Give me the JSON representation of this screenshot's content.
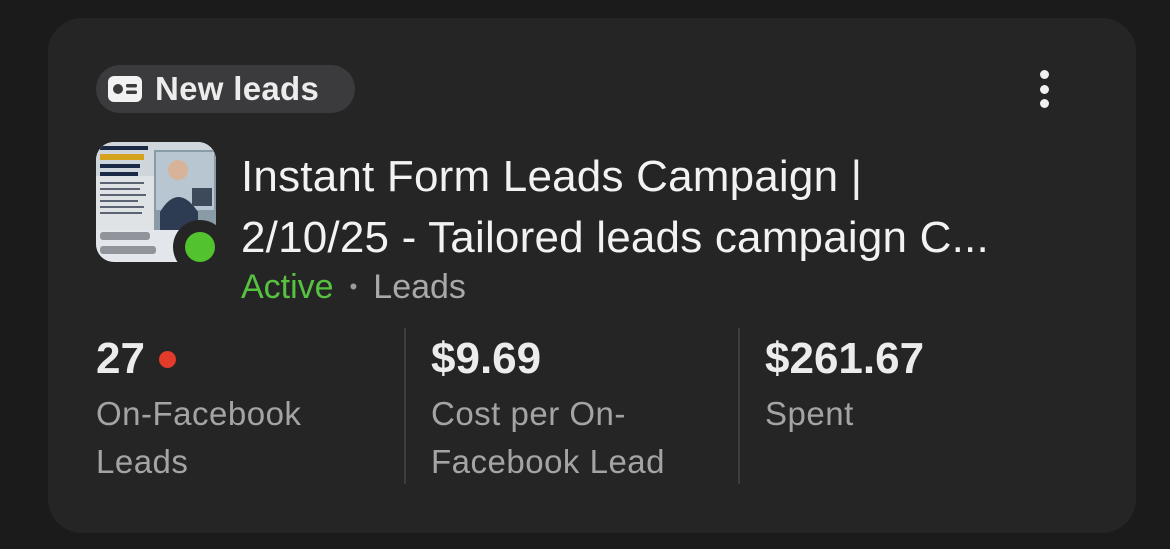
{
  "badge": {
    "label": "New leads",
    "icon": "lead-form-icon"
  },
  "menu": {
    "icon": "more-vertical-icon"
  },
  "campaign": {
    "title_line1": "Instant Form Leads Campaign |",
    "title_line2": "2/10/25 - Tailored leads campaign C...",
    "status": "Active",
    "separator": "•",
    "objective": "Leads",
    "status_color": "#52c22f"
  },
  "thumbnail": {
    "line1": "Claim your",
    "line2": "$39 SPECIAL"
  },
  "stats": [
    {
      "value": "27",
      "label": "On-Facebook Leads",
      "has_alert": true
    },
    {
      "value": "$9.69",
      "label": "Cost per On-Facebook Lead"
    },
    {
      "value": "$261.67",
      "label": "Spent"
    }
  ]
}
